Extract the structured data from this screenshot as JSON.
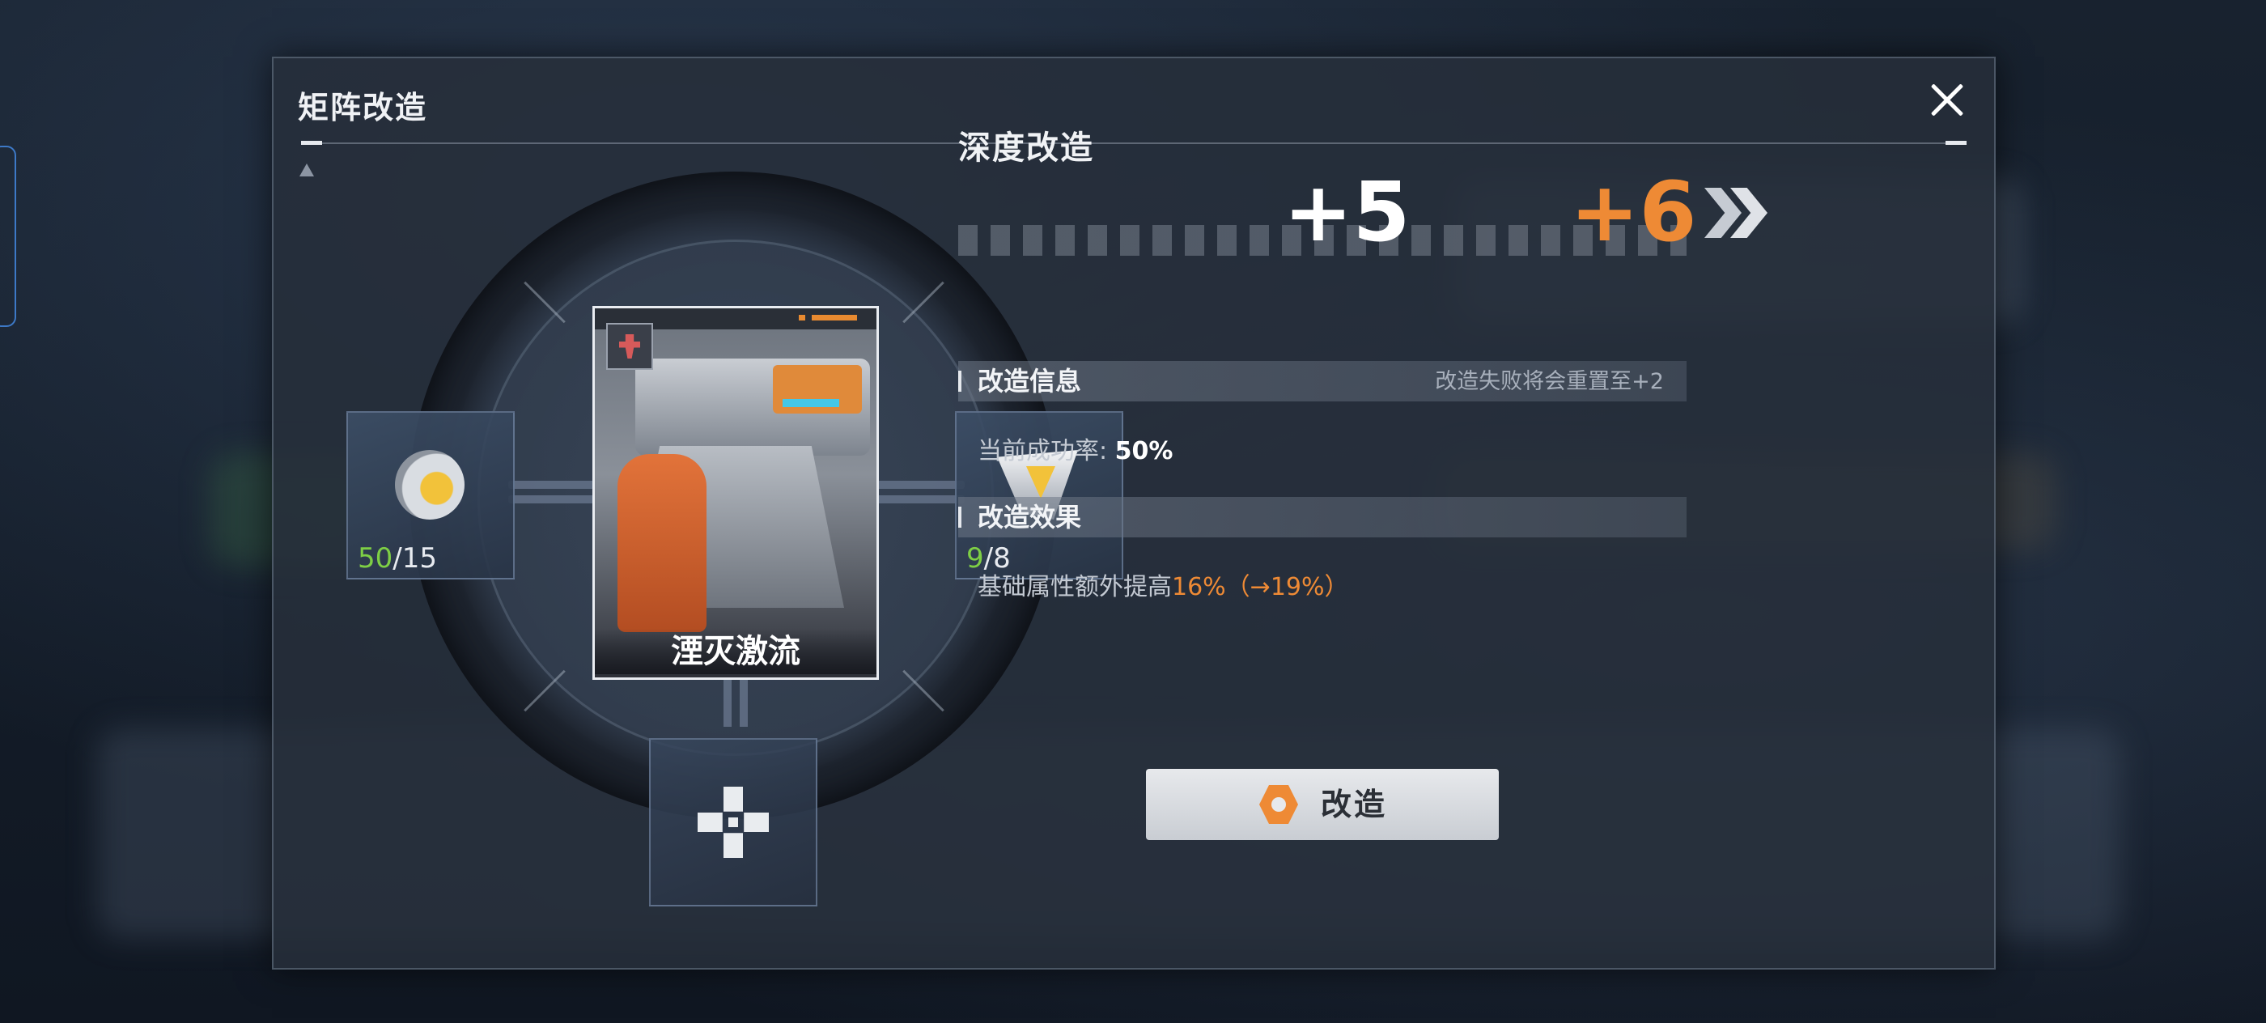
{
  "modal": {
    "title": "矩阵改造"
  },
  "materials": {
    "left": {
      "have": "50",
      "sep_need": "/15"
    },
    "right": {
      "have": "9",
      "sep_need": "/8"
    }
  },
  "card": {
    "name": "湮灭激流"
  },
  "upgrade": {
    "title": "深度改造",
    "current_level": "+5",
    "next_level": "+6"
  },
  "info_section": {
    "title": "改造信息",
    "note": "改造失败将会重置至+2",
    "success_label": "当前成功率:",
    "success_value": "50%"
  },
  "effect_section": {
    "title": "改造效果",
    "desc_prefix": "基础属性额外提高",
    "desc_value": "16%（→19%）"
  },
  "action_button": {
    "label": "改造"
  },
  "colors": {
    "accent_orange": "#ee8a35",
    "count_green": "#7ecf45"
  }
}
